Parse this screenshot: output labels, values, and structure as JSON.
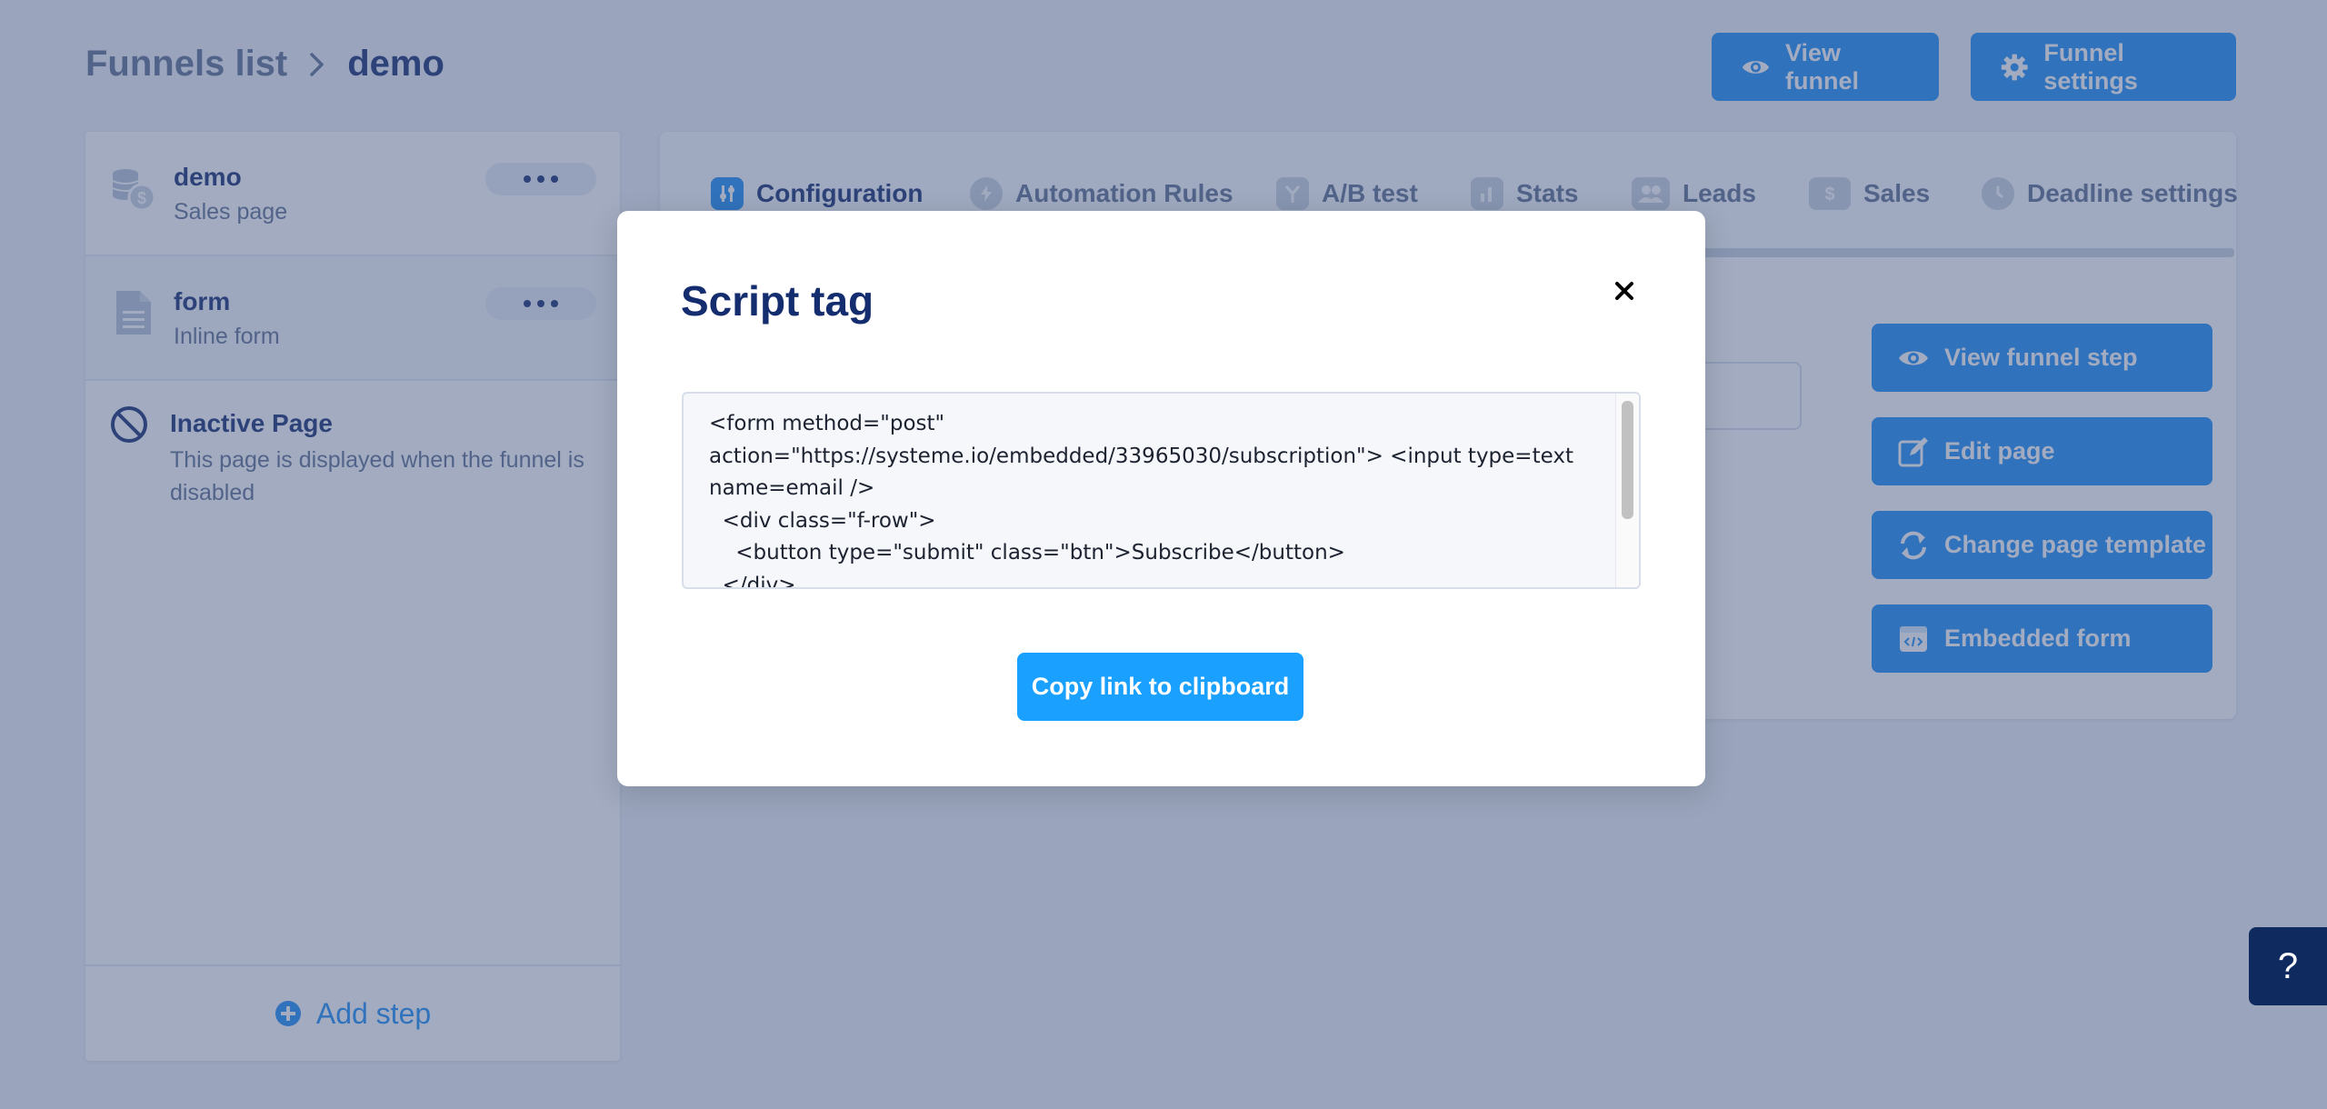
{
  "breadcrumb": {
    "parent": "Funnels list",
    "current": "demo"
  },
  "header": {
    "view_funnel_label": "View funnel",
    "funnel_settings_label": "Funnel settings"
  },
  "sidebar": {
    "steps": [
      {
        "title": "demo",
        "subtitle": "Sales page"
      },
      {
        "title": "form",
        "subtitle": "Inline form"
      }
    ],
    "inactive_page": {
      "title": "Inactive Page",
      "description": "This page is displayed when the funnel is disabled"
    },
    "add_step_label": "Add step"
  },
  "tabs": [
    {
      "label": "Configuration",
      "active": true
    },
    {
      "label": "Automation Rules"
    },
    {
      "label": "A/B test"
    },
    {
      "label": "Stats"
    },
    {
      "label": "Leads"
    },
    {
      "label": "Sales"
    },
    {
      "label": "Deadline settings"
    }
  ],
  "actions": {
    "view_funnel_step": "View funnel step",
    "edit_page": "Edit page",
    "change_page_template": "Change page template",
    "embedded_form": "Embedded form"
  },
  "modal": {
    "title": "Script tag",
    "code": "<form method=\"post\"\naction=\"https://systeme.io/embedded/33965030/subscription\"> <input type=text\nname=email />\n  <div class=\"f-row\">\n    <button type=\"submit\" class=\"btn\">Subscribe</button>\n  </div>",
    "copy_label": "Copy link to clipboard"
  },
  "help": {
    "label": "?"
  },
  "colors": {
    "primary": "#1a8cf5",
    "navy": "#142d6f",
    "muted": "#5e6f91",
    "help_bg": "#0f2a5e"
  }
}
